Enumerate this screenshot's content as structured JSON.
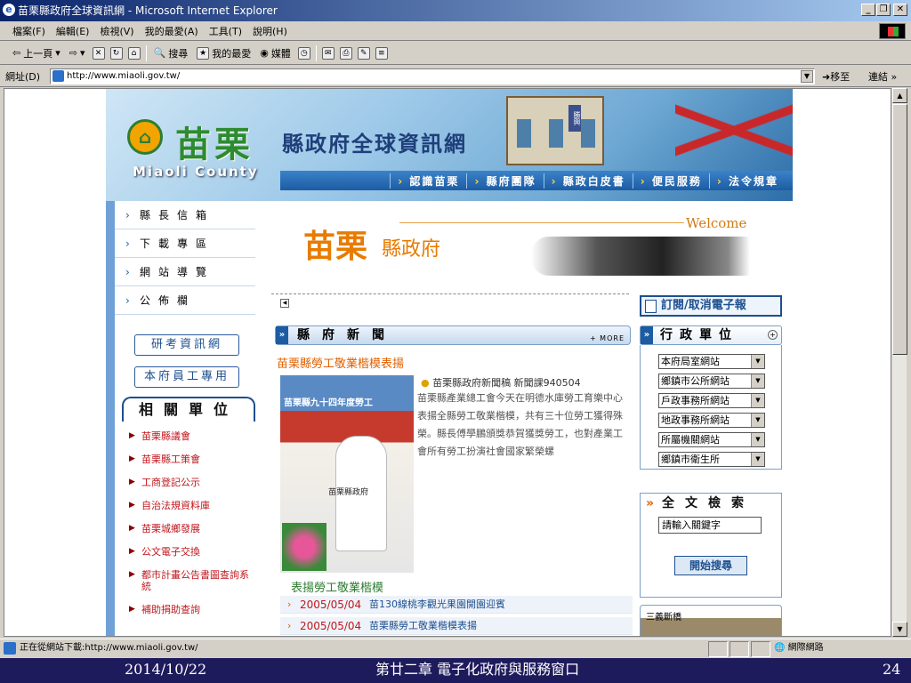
{
  "window": {
    "title": "苗栗縣政府全球資訊網 - Microsoft Internet Explorer"
  },
  "menu": [
    "檔案(F)",
    "編輯(E)",
    "檢視(V)",
    "我的最愛(A)",
    "工具(T)",
    "說明(H)"
  ],
  "toolbar": {
    "back": "上一頁",
    "search": "搜尋",
    "favorites": "我的最愛",
    "media": "媒體"
  },
  "address": {
    "label": "網址(D)",
    "url": "http://www.miaoli.gov.tw/",
    "go": "移至",
    "links": "連結"
  },
  "site": {
    "logo_cn": "苗栗",
    "logo_sub": "縣政府全球資訊網",
    "logo_en": "Miaoli County",
    "banner_sign": "勝興",
    "topnav": [
      "認識苗栗",
      "縣府團隊",
      "縣政白皮書",
      "便民服務",
      "法令規章"
    ],
    "leftmenu": [
      "縣長信箱",
      "下載專區",
      "網站導覽",
      "公佈欄"
    ],
    "leftbuttons": [
      "研考資訊網",
      "本府員工專用"
    ],
    "related_title": "相關單位",
    "related_links": [
      "苗栗縣議會",
      "苗栗縣工策會",
      "工商登記公示",
      "自治法規資料庫",
      "苗栗城鄉發展",
      "公文電子交換",
      "都市計畫公告書圖查詢系統",
      "補助捐助查詢"
    ],
    "welcome_cn": "苗栗",
    "welcome_cn2": "縣政府",
    "welcome_en": "Welcome",
    "news": {
      "header": "縣府新聞",
      "more": "+ MORE",
      "title": "苗栗縣勞工敬業楷模表揚",
      "photo_banner": "苗栗縣九十四年度勞工",
      "photo_caption_text": "苗栗縣政府",
      "meta": "苗栗縣政府新聞稿 新聞課940504",
      "body": "苗栗縣產業總工會今天在明德水庫勞工育樂中心表揚全縣勞工敬業楷模，共有三十位勞工獲得殊榮。縣長傅學鵬頒獎恭賀獲獎勞工，也對產業工會所有勞工扮演社會國家繁榮螺",
      "photo_caption": "表揚勞工敬業楷模",
      "items": [
        {
          "date": "2005/05/04",
          "title": "苗130線桃李觀光果園開園迎賓"
        },
        {
          "date": "2005/05/04",
          "title": "苗栗縣勞工敬業楷模表揚"
        }
      ]
    },
    "subscribe": "訂閱/取消電子報",
    "agency_title": "行政單位",
    "agency_selects": [
      "本府局室網站",
      "鄉鎮市公所網站",
      "戶政事務所網站",
      "地政事務所網站",
      "所屬機關網站",
      "鄉鎮市衛生所"
    ],
    "search_title": "全文檢索",
    "search_placeholder": "請輸入關鍵字",
    "search_button": "開始搜尋",
    "bridge_label": "三義斷橋"
  },
  "status": {
    "text": "正在從網站下載:http://www.miaoli.gov.tw/",
    "zone": "網際網路"
  },
  "footer": {
    "date": "2014/10/22",
    "title": "第廿二章 電子化政府與服務窗口",
    "page": "24"
  }
}
